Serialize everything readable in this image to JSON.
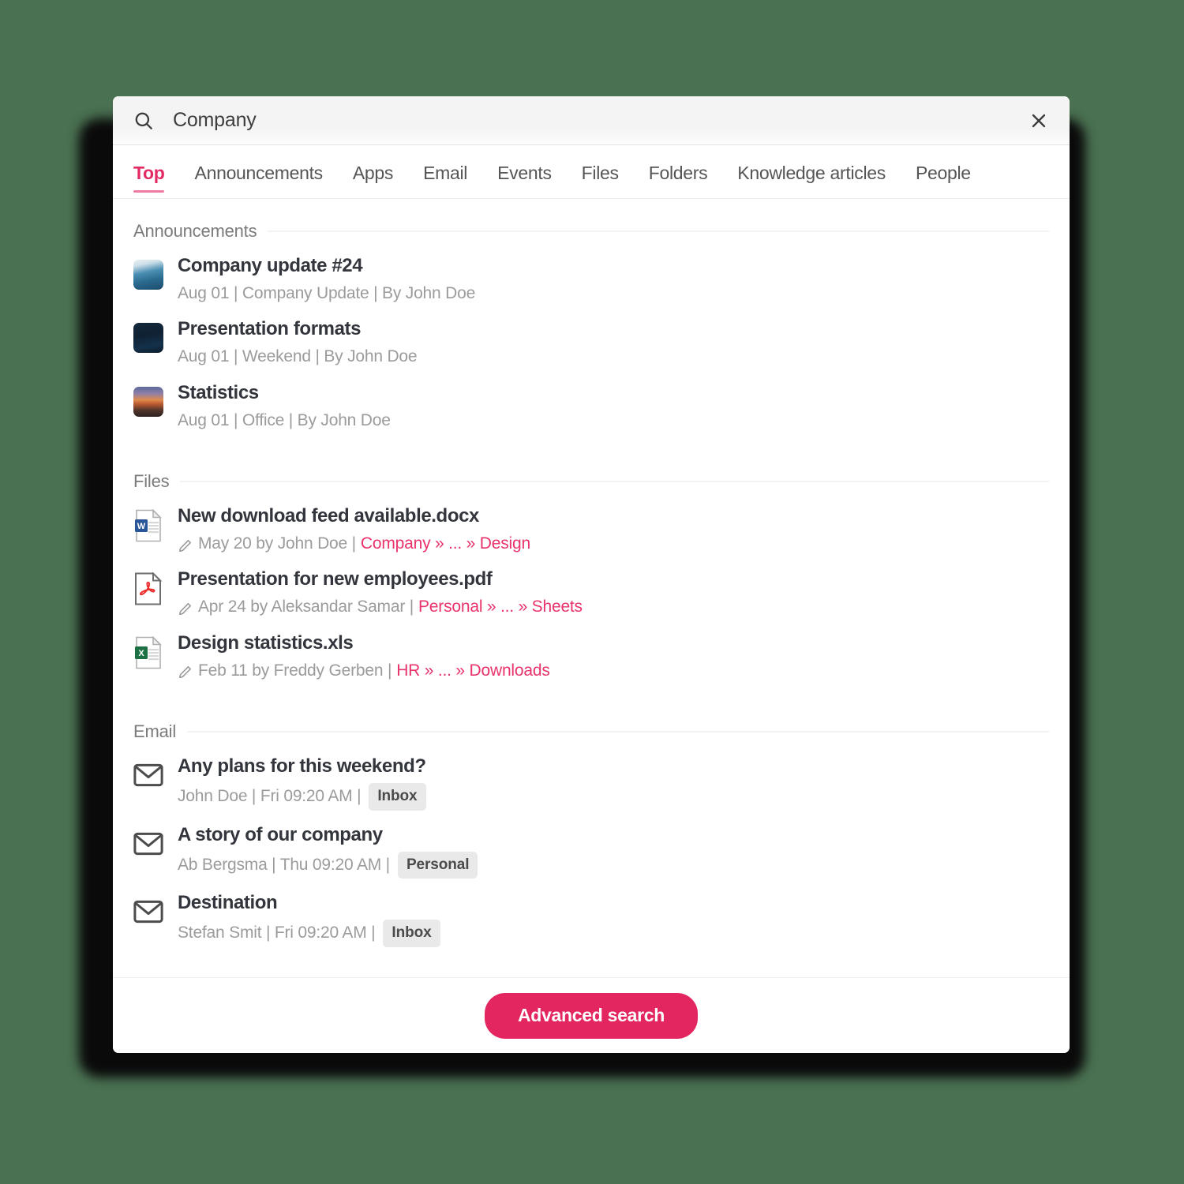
{
  "theme": {
    "page_background": "#4a7152",
    "accent_pink": "#e3265f",
    "link_pink": "#e8336b",
    "tab_underline": "#f07ba0",
    "badge_background": "#e9e9e9"
  },
  "search": {
    "icon": "search-icon",
    "value": "Company",
    "placeholder": "Search",
    "close_icon": "close-icon"
  },
  "tabs": [
    {
      "label": "Top",
      "active": true
    },
    {
      "label": "Announcements",
      "active": false
    },
    {
      "label": "Apps",
      "active": false
    },
    {
      "label": "Email",
      "active": false
    },
    {
      "label": "Events",
      "active": false
    },
    {
      "label": "Files",
      "active": false
    },
    {
      "label": "Folders",
      "active": false
    },
    {
      "label": "Knowledge articles",
      "active": false
    },
    {
      "label": "People",
      "active": false
    }
  ],
  "sections": {
    "announcements": {
      "title": "Announcements",
      "items": [
        {
          "thumb": "announcement-thumbnail-water",
          "title": "Company update #24",
          "date": "Aug 01",
          "category": "Company Update",
          "author": "By John Doe",
          "meta": "Aug 01 | Company Update | By John Doe"
        },
        {
          "thumb": "announcement-thumbnail-nightsky",
          "title": "Presentation formats",
          "date": "Aug 01",
          "category": "Weekend",
          "author": "By John Doe",
          "meta": "Aug 01 | Weekend | By John Doe"
        },
        {
          "thumb": "announcement-thumbnail-sunset",
          "title": "Statistics",
          "date": "Aug 01",
          "category": "Office",
          "author": "By John Doe",
          "meta": "Aug 01 | Office | By John Doe"
        }
      ]
    },
    "files": {
      "title": "Files",
      "items": [
        {
          "icon": "word-document-icon",
          "title": "New download feed available.docx",
          "meta": "May 20 by John Doe |",
          "path": "Company » ... » Design"
        },
        {
          "icon": "pdf-document-icon",
          "title": "Presentation for new employees.pdf",
          "meta": "Apr 24 by Aleksandar Samar |",
          "path": "Personal » ... » Sheets"
        },
        {
          "icon": "excel-document-icon",
          "title": "Design statistics.xls",
          "meta": "Feb 11 by Freddy Gerben |",
          "path": "HR » ... » Downloads"
        }
      ]
    },
    "email": {
      "title": "Email",
      "items": [
        {
          "icon": "envelope-icon",
          "title": "Any plans for this weekend?",
          "meta": "John Doe | Fri 09:20 AM |",
          "folder": "Inbox"
        },
        {
          "icon": "envelope-icon",
          "title": "A story of our company",
          "meta": "Ab Bergsma | Thu 09:20 AM |",
          "folder": "Personal"
        },
        {
          "icon": "envelope-icon",
          "title": "Destination",
          "meta": "Stefan Smit | Fri 09:20 AM |",
          "folder": "Inbox"
        }
      ]
    }
  },
  "footer": {
    "advanced_search_label": "Advanced search"
  }
}
